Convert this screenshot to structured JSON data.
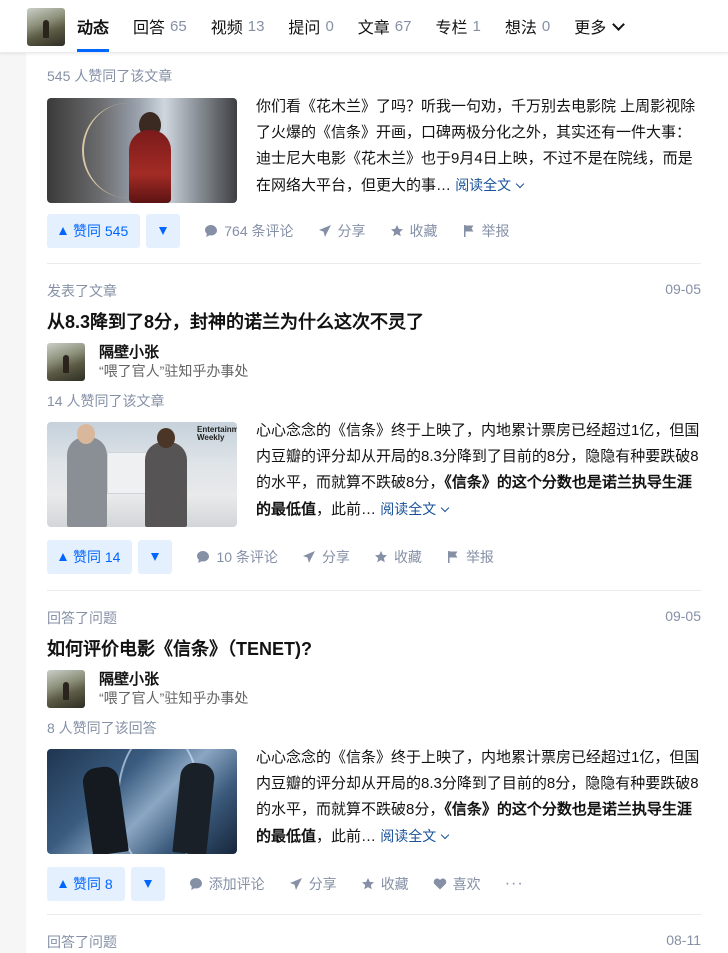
{
  "tabs": [
    {
      "label": "动态",
      "count": "",
      "active": true
    },
    {
      "label": "回答",
      "count": "65"
    },
    {
      "label": "视频",
      "count": "13"
    },
    {
      "label": "提问",
      "count": "0"
    },
    {
      "label": "文章",
      "count": "67"
    },
    {
      "label": "专栏",
      "count": "1"
    },
    {
      "label": "想法",
      "count": "0"
    },
    {
      "label": "更多",
      "count": ""
    }
  ],
  "feed": [
    {
      "votes_line": "545 人赞同了该文章",
      "excerpt_plain": "你们看《花木兰》了吗？听我一句劝，千万别去电影院 上周影视除了火爆的《信条》开画，口碑两极分化之外，其实还有一件大事：迪士尼大电影《花木兰》也于9月4日上映，不过不是在院线，而是在网络大平台，但更大的事…",
      "read_more": "阅读全文",
      "vote_up": "赞同 545",
      "comments": "764 条评论",
      "share": "分享",
      "collect": "收藏",
      "report": "举报"
    },
    {
      "action": "发表了文章",
      "date": "09-05",
      "title": "从8.3降到了8分，封神的诺兰为什么这次不灵了",
      "author_name": "隔壁小张",
      "author_bio": "“喂了官人”驻知乎办事处",
      "votes_line": "14 人赞同了该文章",
      "excerpt_plain": "心心念念的《信条》终于上映了，内地累计票房已经超过1亿，但国内豆瓣的评分却从开局的8.3分降到了目前的8分，隐隐有种要跌破8的水平，而就算不跌破8分，",
      "excerpt_bold": "《信条》的这个分数也是诺兰执导生涯的最低值",
      "excerpt_tail": "，此前…",
      "read_more": "阅读全文",
      "vote_up": "赞同 14",
      "comments": "10 条评论",
      "share": "分享",
      "collect": "收藏",
      "report": "举报",
      "thumb_logo": "Entertainment Weekly"
    },
    {
      "action": "回答了问题",
      "date": "09-05",
      "title": "如何评价电影《信条》（TENET)?",
      "author_name": "隔壁小张",
      "author_bio": "“喂了官人”驻知乎办事处",
      "votes_line": "8 人赞同了该回答",
      "excerpt_plain": "心心念念的《信条》终于上映了，内地累计票房已经超过1亿，但国内豆瓣的评分却从开局的8.3分降到了目前的8分，隐隐有种要跌破8的水平，而就算不跌破8分，",
      "excerpt_bold": "《信条》的这个分数也是诺兰执导生涯的最低值",
      "excerpt_tail": "，此前…",
      "read_more": "阅读全文",
      "vote_up": "赞同 8",
      "comments": "添加评论",
      "share": "分享",
      "collect": "收藏",
      "like": "喜欢",
      "more": "···"
    },
    {
      "action": "回答了问题",
      "date": "08-11"
    }
  ],
  "colors": {
    "accent": "#0066ff",
    "muted": "#8590a6",
    "link": "#175199"
  }
}
